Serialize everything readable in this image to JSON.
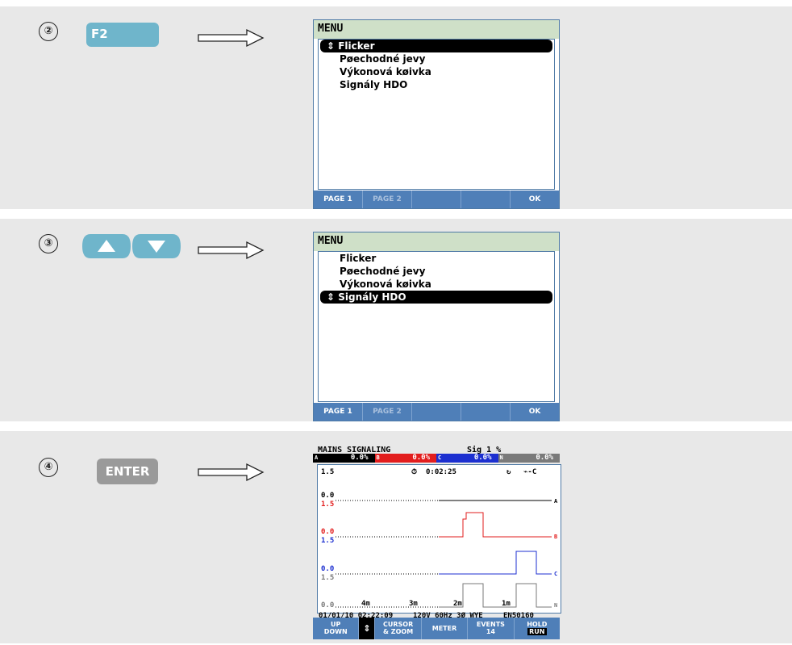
{
  "steps": [
    {
      "number": "②",
      "key_label": "F2",
      "screen": {
        "title": "MENU",
        "items": [
          "Flicker",
          "Pøechodné jevy",
          "Výkonová køivka",
          "Signály HDO"
        ],
        "selected_index": 0,
        "softkeys": [
          "PAGE 1",
          "PAGE 2",
          "",
          "",
          "OK"
        ]
      }
    },
    {
      "number": "③",
      "key_label": "",
      "key_icons": [
        "up-arrow-key",
        "down-arrow-key"
      ],
      "screen": {
        "title": "MENU",
        "items": [
          "Flicker",
          "Pøechodné jevy",
          "Výkonová køivka",
          "Signály HDO"
        ],
        "selected_index": 3,
        "softkeys": [
          "PAGE 1",
          "PAGE 2",
          "",
          "",
          "OK"
        ]
      }
    },
    {
      "number": "④",
      "key_label": "ENTER",
      "scope": {
        "title": "MAINS SIGNALING",
        "sig": "Sig 1 %",
        "phases": [
          {
            "name": "A",
            "value": "0.0%",
            "color": "#000000"
          },
          {
            "name": "B",
            "value": "0.0%",
            "color": "#e21d1d"
          },
          {
            "name": "C",
            "value": "0.0%",
            "color": "#1c2fd0"
          },
          {
            "name": "N",
            "value": "0.0%",
            "color": "#7a7a7a"
          }
        ],
        "top_scale": "1.5",
        "timer": "0:02:25",
        "scales": [
          "0.0",
          "1.5",
          "0.0",
          "1.5",
          "0.0",
          "1.5",
          "0.0"
        ],
        "trace_labels": [
          "A",
          "B",
          "C",
          "N"
        ],
        "time_ticks": [
          "4m",
          "3m",
          "2m",
          "1m"
        ],
        "info": [
          "01/01/10 02:22:09",
          "120V  60Hz 3Ø WYE",
          "EN50160"
        ],
        "softkeys": [
          {
            "line1": "UP",
            "line2": "DOWN"
          },
          {
            "line1": "⇕",
            "line2": ""
          },
          {
            "line1": "CURSOR",
            "line2": "& ZOOM"
          },
          {
            "line1": "METER",
            "line2": ""
          },
          {
            "line1": "EVENTS",
            "line2": "14"
          },
          {
            "line1": "HOLD",
            "line2": "RUN"
          }
        ]
      }
    }
  ]
}
